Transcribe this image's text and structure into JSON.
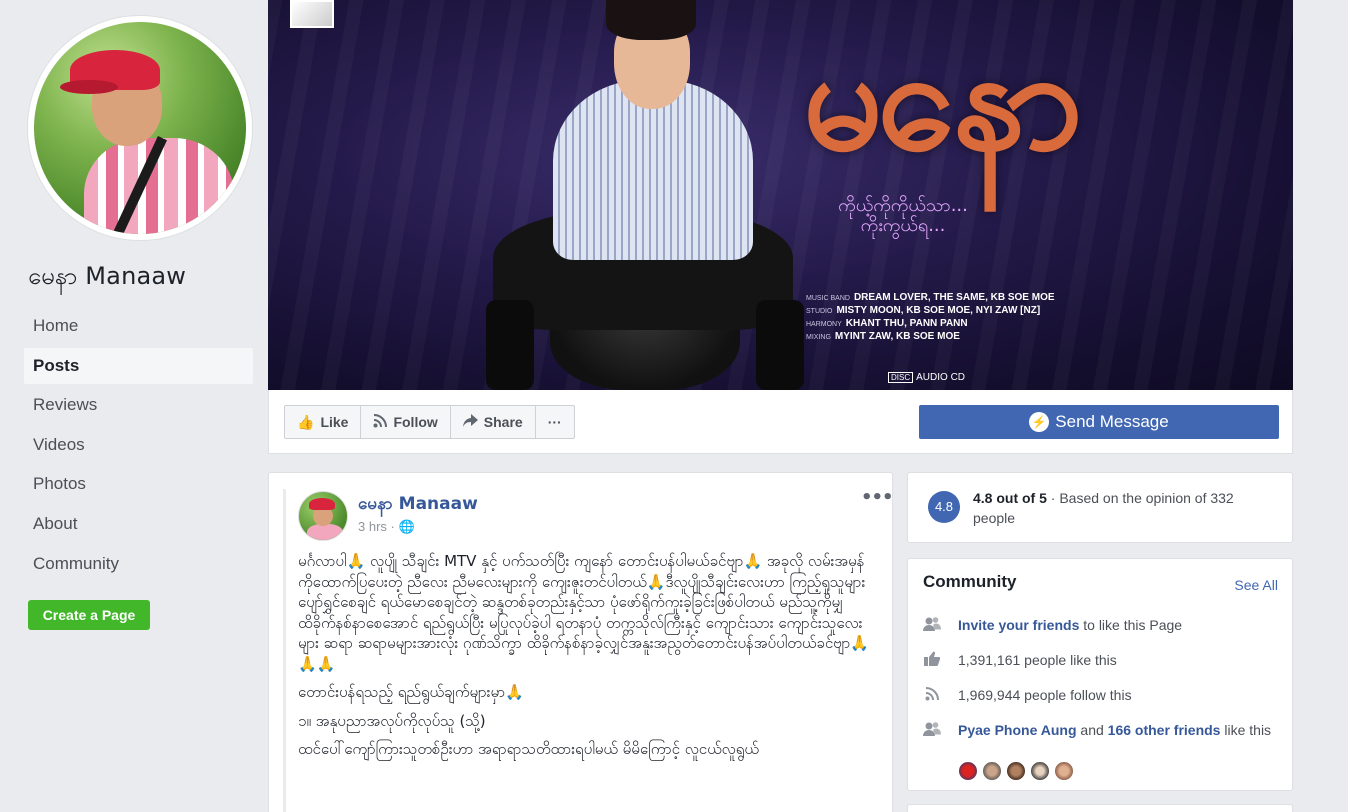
{
  "page": {
    "name": "မေနာ Manaaw"
  },
  "sidebar": {
    "items": [
      {
        "label": "Home",
        "active": false
      },
      {
        "label": "Posts",
        "active": true
      },
      {
        "label": "Reviews",
        "active": false
      },
      {
        "label": "Videos",
        "active": false
      },
      {
        "label": "Photos",
        "active": false
      },
      {
        "label": "About",
        "active": false
      },
      {
        "label": "Community",
        "active": false
      }
    ],
    "create_page_label": "Create a Page"
  },
  "cover": {
    "title_art": "မနော",
    "subtitle": "ကိုယ့်ကိုကိုယ်သာ... ကိုးကွယ်ရ...",
    "credits": [
      {
        "k": "MUSIC BAND",
        "v": "DREAM LOVER, THE SAME, KB SOE MOE"
      },
      {
        "k": "STUDIO",
        "v": "MISTY MOON, KB SOE MOE, NYI ZAW [NZ]"
      },
      {
        "k": "HARMONY",
        "v": "KHANT THU, PANN PANN"
      },
      {
        "k": "MIXING",
        "v": "MYINT ZAW, KB SOE MOE"
      }
    ],
    "format": "AUDIO CD"
  },
  "actions": {
    "like": "Like",
    "follow": "Follow",
    "share": "Share",
    "more": "···",
    "send_message": "Send Message"
  },
  "post": {
    "author": "မေနာ Manaaw",
    "time": "3 hrs · ",
    "paragraphs": [
      "မင်္ဂလာပါ🙏 လူပျို သီချင်း MTV နှင့် ပက်သတ်ပြီး ကျနော် တောင်းပန်ပါမယ်ခင်ဗျာ🙏 အခုလို လမ်းအမှန်ကိုထောက်ပြပေးတဲ့ ညီလေး ညီမလေးများကို ကျေးဇူးတင်ပါတယ်🙏ဒီလူပျိုသီချင်းလေးဟာ ကြည့်ရှုသူများ ပျော်ရွှင်စေချင် ရယ်မောစေချင်တဲ့ ဆန္ဒတစ်ခုတည်းနှင့်သာ ပုံဖော်ရိုက်ကူးခဲ့ခြင်းဖြစ်ပါတယ် မည်သူ့ကိုမျှ ထိခိုက်နစ်နာစေအောင် ရည်ရွယ်ပြီး မပြုလုပ်ခဲ့ပါ ရတနာပုံ တက္ကသိုလ်ကြီးနှင့် ကျောင်းသား ကျောင်းသူလေးများ ဆရာ ဆရာမများအားလုံး ဂုဏ်သိက္ခာ ထိခိုက်နစ်နာခဲ့လျှင်အနူးအညွတ်တောင်းပန်အပ်ပါတယ်ခင်ဗျာ🙏🙏🙏",
      "တောင်းပန်ရသည့် ရည်ရွယ်ချက်များမှာ🙏",
      "၁။ အနုပညာအလုပ်ကိုလုပ်သူ (သို့)",
      "ထင်ပေါ်ကျော်ကြားသူတစ်ဦးဟာ အရာရာသတိထားရပါမယ် မိမိကြောင့် လူငယ်လူရွယ်"
    ]
  },
  "rating": {
    "score": "4.8",
    "headline": "4.8 out of 5",
    "detail": " · Based on the opinion of 332 people"
  },
  "community": {
    "title": "Community",
    "see_all": "See All",
    "invite_link": "Invite your friends",
    "invite_rest": " to like this Page",
    "likes": "1,391,161 people like this",
    "follows": "1,969,944 people follow this",
    "friend_name": "Pyae Phone Aung",
    "friend_and": " and ",
    "friend_others": "166 other friends",
    "friend_rest": " like this"
  },
  "colors": {
    "brand": "#4267b2",
    "link": "#365899",
    "create_green": "#42b72a"
  }
}
